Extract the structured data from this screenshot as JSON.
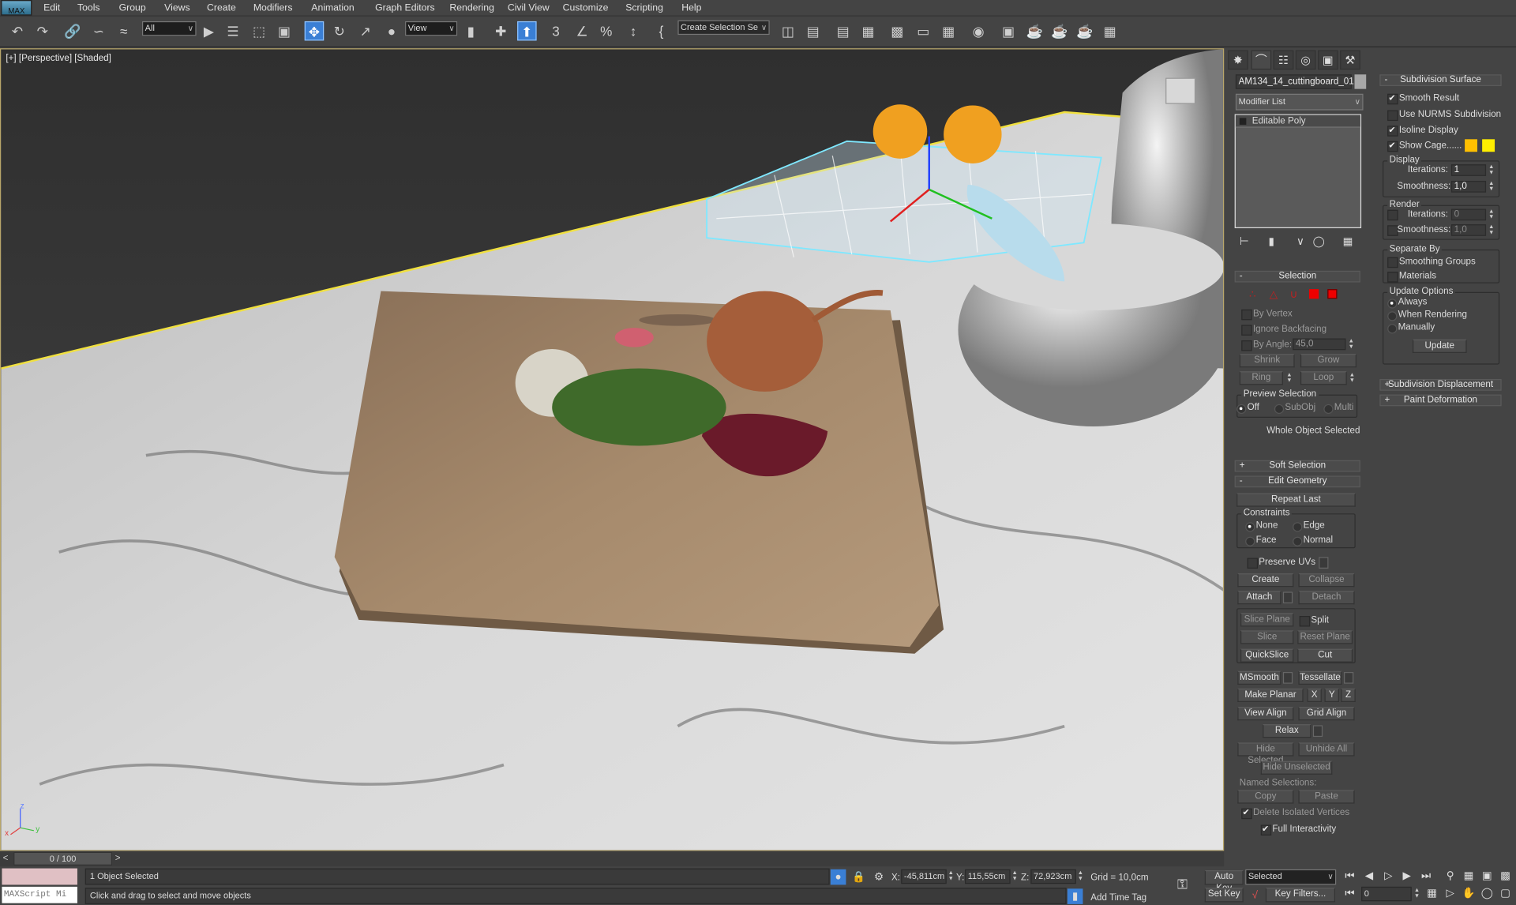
{
  "app": {
    "logo": "MAX"
  },
  "menu": [
    "Edit",
    "Tools",
    "Group",
    "Views",
    "Create",
    "Modifiers",
    "Animation",
    "Graph Editors",
    "Rendering",
    "Civil View",
    "Customize",
    "Scripting",
    "Help"
  ],
  "toolbar": {
    "filter_value": "All",
    "refcoord_value": "View",
    "named_selection_placeholder": "Create Selection Se",
    "snap_3": "3",
    "snap_percent": "%"
  },
  "viewport": {
    "label": "[+] [Perspective] [Shaded]",
    "axis_x": "x",
    "axis_y": "y",
    "axis_z": "z"
  },
  "colors": {
    "accent": "#3a7fd5",
    "cage1": "#ffc000",
    "cage2": "#ffee00",
    "selection_wire": "#7fe8ff"
  },
  "cmd": {
    "object_name": "AM134_14_cuttingboard_01",
    "modifier_list": "Modifier List",
    "stack": [
      "Editable Poly"
    ],
    "selection": {
      "title": "Selection",
      "by_vertex": "By Vertex",
      "ignore_backfacing": "Ignore Backfacing",
      "by_angle": "By Angle:",
      "angle_value": "45,0",
      "shrink": "Shrink",
      "grow": "Grow",
      "ring": "Ring",
      "loop": "Loop",
      "preview": "Preview Selection",
      "off": "Off",
      "subobj": "SubObj",
      "multi": "Multi",
      "status": "Whole Object Selected"
    },
    "soft_selection": "Soft Selection",
    "edit_geometry": {
      "title": "Edit Geometry",
      "repeat_last": "Repeat Last",
      "constraints": "Constraints",
      "none": "None",
      "edge": "Edge",
      "face": "Face",
      "normal": "Normal",
      "preserve_uvs": "Preserve UVs",
      "create": "Create",
      "collapse": "Collapse",
      "attach": "Attach",
      "detach": "Detach",
      "slice_plane": "Slice Plane",
      "split": "Split",
      "slice": "Slice",
      "reset_plane": "Reset Plane",
      "quickslice": "QuickSlice",
      "cut": "Cut",
      "msmooth": "MSmooth",
      "tessellate": "Tessellate",
      "make_planar": "Make Planar",
      "x": "X",
      "y": "Y",
      "z": "Z",
      "view_align": "View Align",
      "grid_align": "Grid Align",
      "relax": "Relax",
      "hide_selected": "Hide Selected",
      "unhide_all": "Unhide All",
      "hide_unselected": "Hide Unselected",
      "named_selections": "Named Selections:",
      "copy": "Copy",
      "paste": "Paste",
      "delete_isolated": "Delete Isolated Vertices",
      "full_interactivity": "Full Interactivity"
    },
    "subdiv": {
      "title": "Subdivision Surface",
      "smooth_result": "Smooth Result",
      "use_nurms": "Use NURMS Subdivision",
      "isoline": "Isoline Display",
      "show_cage": "Show Cage......",
      "display": "Display",
      "iterations": "Iterations:",
      "smoothness": "Smoothness:",
      "disp_iter": "1",
      "disp_smooth": "1,0",
      "render": "Render",
      "rend_iter": "0",
      "rend_smooth": "1,0",
      "separate_by": "Separate By",
      "smoothing_groups": "Smoothing Groups",
      "materials": "Materials",
      "update_options": "Update Options",
      "always": "Always",
      "when_rendering": "When Rendering",
      "manually": "Manually",
      "update": "Update"
    },
    "subdiv_displacement": "Subdivision Displacement",
    "paint_deformation": "Paint Deformation"
  },
  "timeline": {
    "frame": "0 / 100",
    "prev": "<",
    "next": ">"
  },
  "status": {
    "maxscript": "MAXScript Mi",
    "selected": "1 Object Selected",
    "prompt": "Click and drag to select and move objects",
    "x_label": "X:",
    "x": "-45,811cm",
    "y_label": "Y:",
    "y": "115,55cm",
    "z_label": "Z:",
    "z": "72,923cm",
    "grid": "Grid = 10,0cm",
    "add_time_tag": "Add Time Tag",
    "auto_key": "Auto Key",
    "set_key": "Set Key",
    "key_mode": "Selected",
    "key_filters": "Key Filters...",
    "current_frame": "0"
  }
}
